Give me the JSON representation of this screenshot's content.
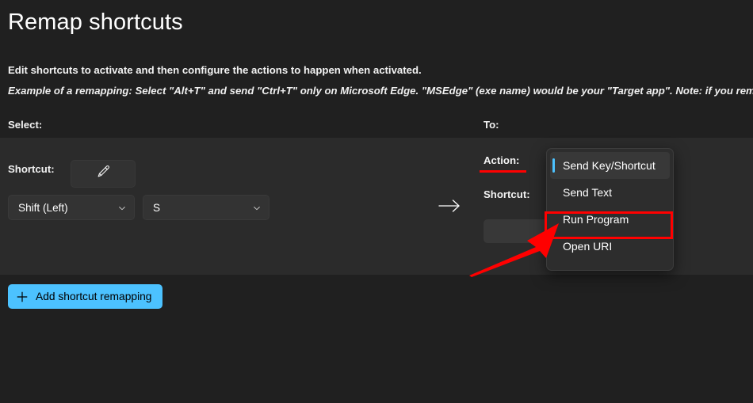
{
  "header": {
    "title": "Remap shortcuts",
    "description_bold": "Edit shortcuts to activate and then configure the actions to happen when activated.",
    "description_italic": "Example of a remapping: Select \"Alt+T\" and send \"Ctrl+T\" only on Microsoft Edge. \"MSEdge\" (exe name) would be your \"Target app\". Note: if you remapped"
  },
  "columns": {
    "select_label": "Select:",
    "to_label": "To:"
  },
  "left_panel": {
    "shortcut_label": "Shortcut:",
    "edit_icon": "pencil-icon",
    "modifier_value": "Shift (Left)",
    "key_value": "S",
    "chevron_icon": "chevron-down-icon"
  },
  "between_panels": {
    "arrow_icon": "arrow-right-icon"
  },
  "right_panel": {
    "action_label": "Action:",
    "shortcut_label": "Shortcut:",
    "dropdown": {
      "selected": "Send Key/Shortcut",
      "options": [
        {
          "label": "Send Key/Shortcut",
          "selected": true,
          "highlighted": false
        },
        {
          "label": "Send Text",
          "selected": false,
          "highlighted": false
        },
        {
          "label": "Run Program",
          "selected": false,
          "highlighted": true
        },
        {
          "label": "Open URI",
          "selected": false,
          "highlighted": false
        }
      ]
    }
  },
  "footer": {
    "add_button_label": "Add shortcut remapping",
    "add_button_icon": "plus-icon"
  },
  "annotations": {
    "action_underline_color": "#ff0000",
    "highlight_box_color": "#ff0000",
    "arrow_color": "#ff0000",
    "arrow_icon": "red-arrow-up-right-icon"
  },
  "colors": {
    "page_background": "#202020",
    "card_background": "#2b2b2b",
    "accent": "#4cc2ff",
    "dropdown_background": "#2d2d2d",
    "selected_item_background": "#383838",
    "text_primary": "#ffffff"
  }
}
